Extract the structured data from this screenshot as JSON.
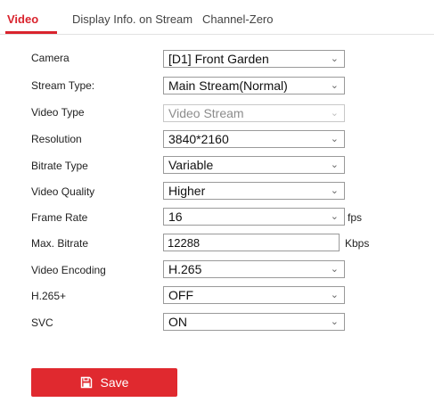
{
  "tabs": [
    {
      "label": "Video",
      "active": true
    },
    {
      "label": "Display Info. on Stream",
      "active": false
    },
    {
      "label": "Channel-Zero",
      "active": false
    }
  ],
  "form": {
    "camera": {
      "label": "Camera",
      "value": "[D1] Front Garden"
    },
    "stream_type": {
      "label": "Stream Type:",
      "value": "Main Stream(Normal)"
    },
    "video_type": {
      "label": "Video Type",
      "value": "Video Stream",
      "disabled": true
    },
    "resolution": {
      "label": "Resolution",
      "value": "3840*2160"
    },
    "bitrate_type": {
      "label": "Bitrate Type",
      "value": "Variable"
    },
    "video_quality": {
      "label": "Video Quality",
      "value": "Higher"
    },
    "frame_rate": {
      "label": "Frame Rate",
      "value": "16",
      "unit": "fps"
    },
    "max_bitrate": {
      "label": "Max. Bitrate",
      "value": "12288",
      "unit": "Kbps"
    },
    "video_encoding": {
      "label": "Video Encoding",
      "value": "H.265"
    },
    "h265_plus": {
      "label": "H.265+",
      "value": "OFF"
    },
    "svc": {
      "label": "SVC",
      "value": "ON"
    }
  },
  "save_button": {
    "label": "Save",
    "icon": "floppy-disk-icon"
  },
  "colors": {
    "accent": "#d9232d",
    "button": "#e0292f"
  }
}
